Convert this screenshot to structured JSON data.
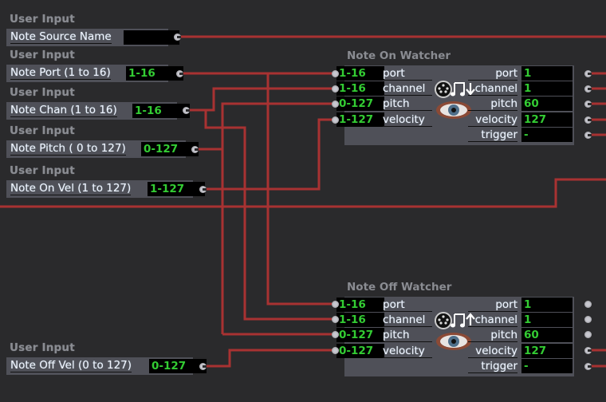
{
  "colors": {
    "wire": "#a83232",
    "value_text": "#33cc33",
    "panel": "#4f5058",
    "background": "#2a2a2c"
  },
  "user_inputs": [
    {
      "title": "User Input",
      "label": "Note Source Name",
      "value": ""
    },
    {
      "title": "User Input",
      "label": "Note Port (1 to 16)",
      "value": "1-16"
    },
    {
      "title": "User Input",
      "label": "Note Chan (1 to 16)",
      "value": "1-16"
    },
    {
      "title": "User Input",
      "label": "Note Pitch ( 0 to 127)",
      "value": "0-127"
    },
    {
      "title": "User Input",
      "label": "Note On Vel (1 to 127)",
      "value": "1-127"
    },
    {
      "title": "User Input",
      "label": "Note Off Vel (0 to 127)",
      "value": "0-127"
    }
  ],
  "note_on_watcher": {
    "title": "Note On Watcher",
    "icon": "midi-note-on-eye-icon",
    "inputs": [
      {
        "label": "port",
        "value": "1-16"
      },
      {
        "label": "channel",
        "value": "1-16"
      },
      {
        "label": "pitch",
        "value": "0-127"
      },
      {
        "label": "velocity",
        "value": "1-127"
      }
    ],
    "outputs": [
      {
        "label": "port",
        "value": "1"
      },
      {
        "label": "channel",
        "value": "1"
      },
      {
        "label": "pitch",
        "value": "60"
      },
      {
        "label": "velocity",
        "value": "127"
      },
      {
        "label": "trigger",
        "value": "-"
      }
    ]
  },
  "note_off_watcher": {
    "title": "Note Off Watcher",
    "icon": "midi-note-off-eye-icon",
    "inputs": [
      {
        "label": "port",
        "value": "1-16"
      },
      {
        "label": "channel",
        "value": "1-16"
      },
      {
        "label": "pitch",
        "value": "0-127"
      },
      {
        "label": "velocity",
        "value": "0-127"
      }
    ],
    "outputs": [
      {
        "label": "port",
        "value": "1"
      },
      {
        "label": "channel",
        "value": "1"
      },
      {
        "label": "pitch",
        "value": "60"
      },
      {
        "label": "velocity",
        "value": "127"
      },
      {
        "label": "trigger",
        "value": "-"
      }
    ]
  }
}
